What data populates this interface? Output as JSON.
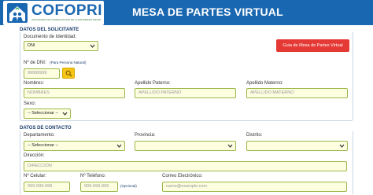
{
  "header": {
    "logo_text": "COFOPRI",
    "logo_subtitle": "ORGANISMO DE FORMALIZACIÓN DE LA PROPIEDAD INFORMAL",
    "title": "MESA DE PARTES VIRTUAL"
  },
  "solicitante": {
    "section_title": "DATOS DEL SOLICITANTE",
    "documento_label": "Documento de Identidad:",
    "documento_value": "DNI",
    "guide_button": "Guia de Mesa de Partes Virtual",
    "dni_label": "Nº de DNI:",
    "dni_note": "(Para Persona Natural)",
    "dni_placeholder": "99999999",
    "nombres_label": "Nombres:",
    "nombres_placeholder": "NOMBRES",
    "apellido_paterno_label": "Apellido Paterno:",
    "apellido_paterno_placeholder": "APELLIDO PATERNO",
    "apellido_materno_label": "Apellido Materno:",
    "apellido_materno_placeholder": "APELLIDO MATERNO",
    "sexo_label": "Sexo:",
    "sexo_value": "-- Seleccionar --"
  },
  "contacto": {
    "section_title": "DATOS DE CONTACTO",
    "departamento_label": "Departamento:",
    "departamento_value": "-- Seleccionar --",
    "provincia_label": "Provincia:",
    "provincia_value": "",
    "distrito_label": "Distrito:",
    "distrito_value": "",
    "direccion_label": "Dirección:",
    "direccion_placeholder": "DIRECCIÓN",
    "celular_label": "Nº Celular:",
    "celular_placeholder": "999-999-999",
    "telefono_label": "Nº Teléfono:",
    "telefono_note": "(Opcional)",
    "telefono_placeholder": "999-999-999",
    "email_label": "Correo Electrónico:",
    "email_placeholder": "name@example.com"
  },
  "colors": {
    "header_bg": "#1a67b1",
    "field_bg": "#fdfde0",
    "field_border": "#9ab84a",
    "guide_button": "#e53935",
    "search_button": "#f5c518"
  },
  "icons": {
    "logo": "cofopri-emblem",
    "search": "search-icon",
    "chevron": "chevron-down-icon"
  }
}
